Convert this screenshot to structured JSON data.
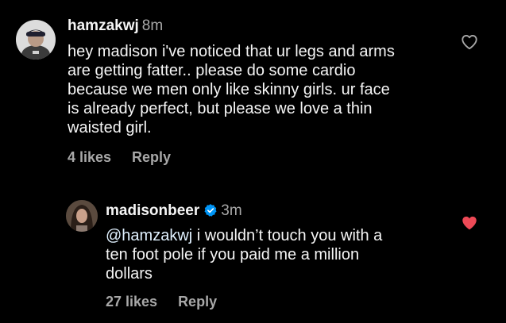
{
  "comments": [
    {
      "username": "hamzakwj",
      "time": "8m",
      "lines": [
        "hey madison i've noticed that ur legs and arms",
        "are getting fatter.. please do some cardio",
        "because we men only like skinny girls. ur face",
        "is already perfect, but please we love a thin",
        "waisted girl."
      ],
      "likes": "4 likes",
      "reply": "Reply",
      "liked": false,
      "like_icon": "heart-outline-icon",
      "like_color": "#a8a8a8"
    },
    {
      "username": "madisonbeer",
      "time": "3m",
      "verified": true,
      "mention": "@hamzakwj",
      "lines": [
        " i wouldn’t touch you with a",
        "ten foot pole if you paid me a million",
        "dollars"
      ],
      "likes": "27 likes",
      "reply": "Reply",
      "liked": true,
      "like_icon": "heart-filled-icon",
      "like_color": "#ed4956"
    }
  ],
  "colors": {
    "background": "#000000",
    "text": "#f5f5f5",
    "secondary_text": "#a8a8a8",
    "mention": "#e0f1ff",
    "verified": "#0095f6",
    "liked_heart": "#ed4956"
  }
}
